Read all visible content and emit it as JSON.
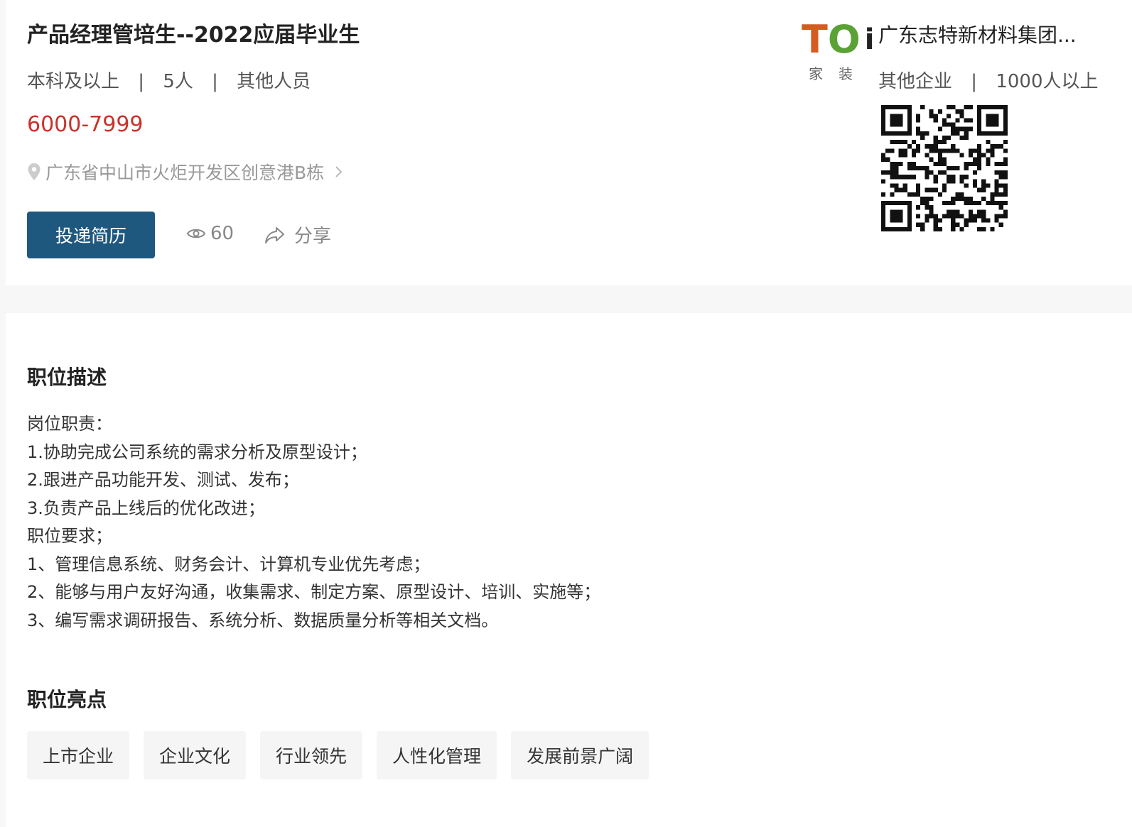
{
  "job": {
    "title": "产品经理管培生--2022应届毕业生",
    "education": "本科及以上",
    "headcount": "5人",
    "category": "其他人员",
    "separator": "|",
    "salary": "6000-7999",
    "location": "广东省中山市火炬开发区创意港B栋",
    "apply_label": "投递简历",
    "views": "60",
    "share_label": "分享"
  },
  "company": {
    "logo_text_t": "T",
    "logo_text_o": "O",
    "logo_text_dot": "i",
    "logo_sub": "家装",
    "name": "广东志特新材料集团...",
    "type": "其他企业",
    "size": "1000人以上"
  },
  "description": {
    "title": "职位描述",
    "lines": [
      "岗位职责：",
      "1.协助完成公司系统的需求分析及原型设计；",
      "2.跟进产品功能开发、测试、发布；",
      "3.负责产品上线后的优化改进；",
      "职位要求；",
      "1、管理信息系统、财务会计、计算机专业优先考虑；",
      "2、能够与用户友好沟通，收集需求、制定方案、原型设计、培训、实施等；",
      "3、编写需求调研报告、系统分析、数据质量分析等相关文档。"
    ]
  },
  "highlights": {
    "title": "职位亮点",
    "tags": [
      "上市企业",
      "企业文化",
      "行业领先",
      "人性化管理",
      "发展前景广阔"
    ]
  },
  "colors": {
    "accent": "#1f587f",
    "salary": "#c8332c",
    "logo_orange": "#d75b21",
    "logo_green": "#5aa235"
  }
}
